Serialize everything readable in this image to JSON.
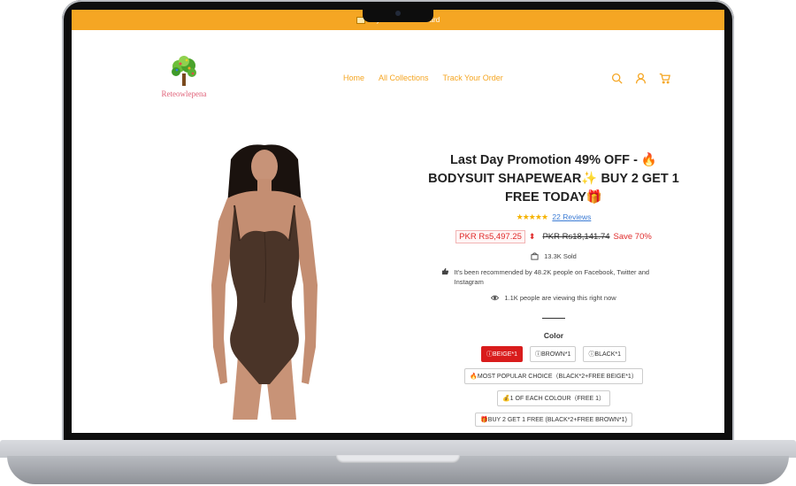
{
  "banner": {
    "text": "Payment ... CreditCard"
  },
  "logo": {
    "text": "Reteowlepena"
  },
  "nav": {
    "items": [
      "Home",
      "All Collections",
      "Track Your Order"
    ]
  },
  "header_icons": [
    "search-icon",
    "user-icon",
    "cart-icon"
  ],
  "product": {
    "title": "Last Day Promotion 49% OFF - 🔥BODYSUIT SHAPEWEAR✨ BUY 2 GET 1 FREE TODAY🎁",
    "stars": "★★★★★",
    "reviews": "22 Reviews",
    "price_now": "PKR Rs5,497.25",
    "price_old": "PKR Rs18,141.74",
    "save": "Save 70%",
    "sold": "13.3K Sold",
    "recommended": "It's been recommended by 48.2K people on Facebook, Twitter and Instagram",
    "viewing": "1.1K people are viewing this right now"
  },
  "options": {
    "label": "Color",
    "row1": [
      "ⓘBEIGE*1",
      "ⓘBROWN*1",
      "ⓘBLACK*1"
    ],
    "row2": "🔥MOST POPULAR CHOICE（BLACK*2+FREE BEIGE*1）",
    "row3": "💰1 OF EACH COLOUR（FREE 1）",
    "row4": "🎁BUY 2 GET 1 FREE (BLACK*2+FREE BROWN*1)"
  },
  "colors": {
    "accent": "#f5a623",
    "sale": "#d91c1c",
    "link": "#3b7bd4",
    "product": "#4a3428"
  }
}
